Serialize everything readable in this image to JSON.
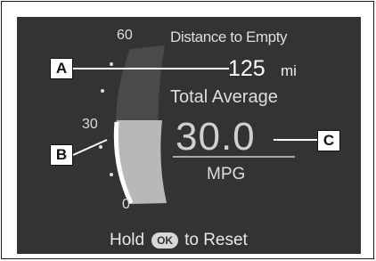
{
  "gauge": {
    "tick_max": "60",
    "tick_mid": "30",
    "tick_min": "0",
    "level_fraction": 0.45
  },
  "distance_to_empty": {
    "title": "Distance to Empty",
    "value": "125",
    "unit": "mi"
  },
  "total_average": {
    "title": "Total Average",
    "value": "30.0",
    "unit": "MPG"
  },
  "reset_hint": {
    "prefix": "Hold",
    "button_label": "OK",
    "suffix": "to Reset"
  },
  "callouts": {
    "a": "A",
    "b": "B",
    "c": "C"
  },
  "colors": {
    "screen_bg": "#333333",
    "text": "#e6e6e6",
    "gauge_track": "#4a4a4a",
    "gauge_fill": "#b8b8b8",
    "gauge_edge": "#ffffff"
  }
}
